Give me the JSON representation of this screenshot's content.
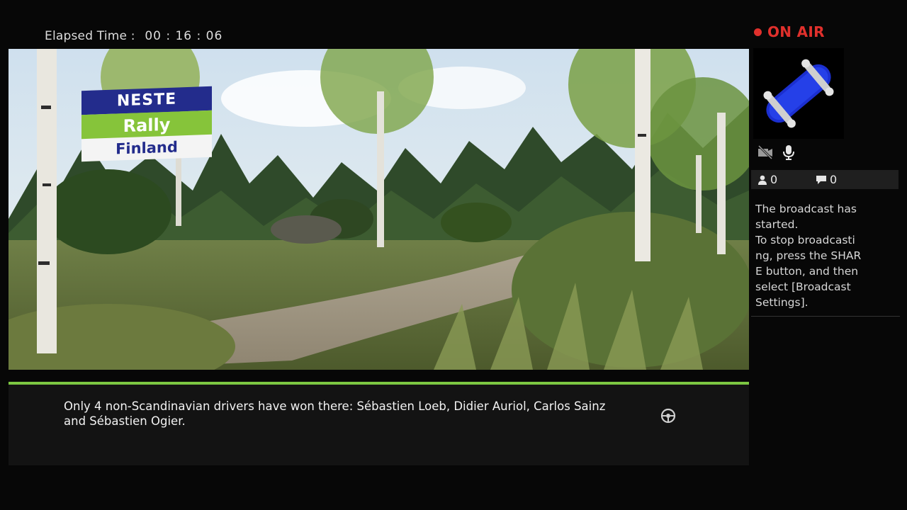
{
  "elapsed": {
    "label": "Elapsed Time :",
    "value": "00 : 16 : 06"
  },
  "game": {
    "logo": {
      "line1": "NESTE",
      "line2": "Rally",
      "line3": "Finland"
    },
    "message": "Only 4 non-Scandinavian drivers have won there: Sébastien Loeb, Didier Auriol, Carlos Sainz and Sébastien Ogier.",
    "accent_color": "#7cc742"
  },
  "broadcast": {
    "status": "ON AIR",
    "status_color": "#e0302c",
    "viewer_count": "0",
    "comment_count": "0",
    "message_lines": [
      "The broadcast has",
      "started.",
      "To stop broadcasti",
      "ng, press the SHAR",
      "E button, and then",
      "select [Broadcast",
      "Settings]."
    ]
  },
  "icons": {
    "camera": "camera-off-icon",
    "mic": "microphone-icon",
    "viewer": "person-icon",
    "comment": "speech-bubble-icon",
    "avatar": "skateboard-avatar",
    "wheel": "steering-wheel-icon"
  }
}
